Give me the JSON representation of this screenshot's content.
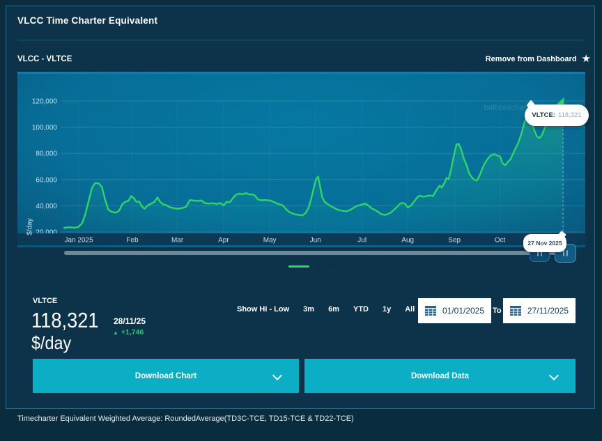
{
  "window": {
    "title": "VLCC Time Charter Equivalent"
  },
  "subheader": {
    "subtitle": "VLCC - VLTCE",
    "remove_label": "Remove from Dashboard",
    "star_icon": "★"
  },
  "chart_data": {
    "type": "line",
    "title": "VLCC Time Charter Equivalent",
    "ylabel": "$/day",
    "ylim": [
      20000,
      120000
    ],
    "grid": true,
    "legend_position": "bottom",
    "watermark": "balticexchange.com",
    "y_ticks": [
      {
        "v": 20000,
        "label": "20,000"
      },
      {
        "v": 40000,
        "label": "40,000"
      },
      {
        "v": 60000,
        "label": "60,000"
      },
      {
        "v": 80000,
        "label": "80,000"
      },
      {
        "v": 100000,
        "label": "100,000"
      },
      {
        "v": 120000,
        "label": "120,000"
      }
    ],
    "x_ticks": [
      {
        "f": 0.028,
        "label": "Jan 2025"
      },
      {
        "f": 0.13,
        "label": "Feb"
      },
      {
        "f": 0.216,
        "label": "Mar"
      },
      {
        "f": 0.304,
        "label": "Apr"
      },
      {
        "f": 0.392,
        "label": "May"
      },
      {
        "f": 0.479,
        "label": "Jun"
      },
      {
        "f": 0.568,
        "label": "Jul"
      },
      {
        "f": 0.655,
        "label": "Aug"
      },
      {
        "f": 0.744,
        "label": "Sep"
      },
      {
        "f": 0.831,
        "label": "Oct"
      }
    ],
    "cursor": {
      "f": 0.951,
      "date": "27 Nov 2025",
      "series_label": "VLTCE:",
      "value_label": "118,321",
      "value": 118321
    },
    "series": [
      {
        "name": "VLTCE",
        "color": "#2fd566",
        "points": [
          [
            0.0,
            23200
          ],
          [
            0.01,
            23600
          ],
          [
            0.02,
            23300
          ],
          [
            0.027,
            23800
          ],
          [
            0.034,
            26500
          ],
          [
            0.04,
            33000
          ],
          [
            0.047,
            44000
          ],
          [
            0.053,
            53500
          ],
          [
            0.059,
            57400
          ],
          [
            0.066,
            57100
          ],
          [
            0.072,
            54500
          ],
          [
            0.078,
            45000
          ],
          [
            0.084,
            37200
          ],
          [
            0.091,
            35300
          ],
          [
            0.099,
            34800
          ],
          [
            0.105,
            36400
          ],
          [
            0.111,
            41300
          ],
          [
            0.117,
            43100
          ],
          [
            0.123,
            44000
          ],
          [
            0.128,
            47400
          ],
          [
            0.133,
            45800
          ],
          [
            0.138,
            42900
          ],
          [
            0.143,
            43400
          ],
          [
            0.148,
            39800
          ],
          [
            0.153,
            37700
          ],
          [
            0.159,
            40100
          ],
          [
            0.166,
            41700
          ],
          [
            0.172,
            42900
          ],
          [
            0.178,
            46400
          ],
          [
            0.183,
            43000
          ],
          [
            0.189,
            41100
          ],
          [
            0.195,
            40500
          ],
          [
            0.201,
            39000
          ],
          [
            0.208,
            38300
          ],
          [
            0.216,
            37700
          ],
          [
            0.224,
            38200
          ],
          [
            0.232,
            39100
          ],
          [
            0.24,
            44400
          ],
          [
            0.248,
            44000
          ],
          [
            0.255,
            43700
          ],
          [
            0.262,
            44100
          ],
          [
            0.268,
            42100
          ],
          [
            0.276,
            41700
          ],
          [
            0.284,
            41900
          ],
          [
            0.291,
            41400
          ],
          [
            0.298,
            42100
          ],
          [
            0.304,
            40300
          ],
          [
            0.31,
            43100
          ],
          [
            0.316,
            42700
          ],
          [
            0.322,
            46100
          ],
          [
            0.328,
            48500
          ],
          [
            0.334,
            49300
          ],
          [
            0.34,
            48800
          ],
          [
            0.347,
            49700
          ],
          [
            0.353,
            48600
          ],
          [
            0.359,
            48800
          ],
          [
            0.364,
            47700
          ],
          [
            0.37,
            44700
          ],
          [
            0.377,
            44200
          ],
          [
            0.383,
            44400
          ],
          [
            0.392,
            44100
          ],
          [
            0.398,
            43300
          ],
          [
            0.404,
            42000
          ],
          [
            0.41,
            41200
          ],
          [
            0.416,
            40500
          ],
          [
            0.422,
            37900
          ],
          [
            0.428,
            35500
          ],
          [
            0.434,
            34300
          ],
          [
            0.441,
            33400
          ],
          [
            0.448,
            33000
          ],
          [
            0.454,
            32700
          ],
          [
            0.46,
            34300
          ],
          [
            0.466,
            38600
          ],
          [
            0.471,
            45500
          ],
          [
            0.476,
            54000
          ],
          [
            0.48,
            60000
          ],
          [
            0.484,
            62400
          ],
          [
            0.488,
            54500
          ],
          [
            0.492,
            46500
          ],
          [
            0.497,
            43000
          ],
          [
            0.503,
            41000
          ],
          [
            0.509,
            39500
          ],
          [
            0.515,
            38300
          ],
          [
            0.521,
            37100
          ],
          [
            0.527,
            36500
          ],
          [
            0.533,
            36000
          ],
          [
            0.539,
            35900
          ],
          [
            0.545,
            36800
          ],
          [
            0.551,
            38300
          ],
          [
            0.557,
            39700
          ],
          [
            0.563,
            40400
          ],
          [
            0.568,
            41000
          ],
          [
            0.574,
            41700
          ],
          [
            0.58,
            40100
          ],
          [
            0.586,
            38100
          ],
          [
            0.592,
            36900
          ],
          [
            0.598,
            35500
          ],
          [
            0.604,
            33700
          ],
          [
            0.61,
            33100
          ],
          [
            0.616,
            33500
          ],
          [
            0.622,
            34700
          ],
          [
            0.628,
            36700
          ],
          [
            0.634,
            38900
          ],
          [
            0.64,
            41500
          ],
          [
            0.645,
            42200
          ],
          [
            0.65,
            41500
          ],
          [
            0.655,
            38700
          ],
          [
            0.661,
            40100
          ],
          [
            0.667,
            43200
          ],
          [
            0.673,
            46400
          ],
          [
            0.678,
            47700
          ],
          [
            0.684,
            46900
          ],
          [
            0.69,
            47300
          ],
          [
            0.697,
            47900
          ],
          [
            0.703,
            47400
          ],
          [
            0.71,
            52200
          ],
          [
            0.716,
            55500
          ],
          [
            0.72,
            53900
          ],
          [
            0.725,
            57500
          ],
          [
            0.729,
            61200
          ],
          [
            0.733,
            60300
          ],
          [
            0.738,
            68500
          ],
          [
            0.743,
            78500
          ],
          [
            0.748,
            86800
          ],
          [
            0.752,
            87400
          ],
          [
            0.757,
            82800
          ],
          [
            0.762,
            75800
          ],
          [
            0.767,
            71300
          ],
          [
            0.772,
            64800
          ],
          [
            0.777,
            61800
          ],
          [
            0.782,
            59800
          ],
          [
            0.787,
            59300
          ],
          [
            0.792,
            63200
          ],
          [
            0.797,
            68200
          ],
          [
            0.802,
            72600
          ],
          [
            0.808,
            76100
          ],
          [
            0.814,
            78700
          ],
          [
            0.82,
            79300
          ],
          [
            0.826,
            78400
          ],
          [
            0.831,
            77700
          ],
          [
            0.836,
            72200
          ],
          [
            0.841,
            71000
          ],
          [
            0.846,
            73600
          ],
          [
            0.851,
            75700
          ],
          [
            0.856,
            80200
          ],
          [
            0.861,
            84300
          ],
          [
            0.866,
            88400
          ],
          [
            0.871,
            94300
          ],
          [
            0.876,
            101500
          ],
          [
            0.881,
            107800
          ],
          [
            0.886,
            109400
          ],
          [
            0.891,
            103800
          ],
          [
            0.896,
            97800
          ],
          [
            0.901,
            93100
          ],
          [
            0.906,
            91600
          ],
          [
            0.911,
            94200
          ],
          [
            0.916,
            99300
          ],
          [
            0.921,
            104200
          ],
          [
            0.926,
            108600
          ],
          [
            0.931,
            110600
          ],
          [
            0.936,
            112400
          ],
          [
            0.941,
            114300
          ],
          [
            0.946,
            116300
          ],
          [
            0.951,
            118321
          ]
        ]
      }
    ]
  },
  "scrollbar": {
    "handle_icon": "pause-bars"
  },
  "stats": {
    "instrument": "VLTCE",
    "value": "118,321",
    "unit": "$/day",
    "date": "28/11/25",
    "change_icon": "▲",
    "change": "+1,746",
    "change_color": "#2ecc71"
  },
  "controls": {
    "hi_low_label": "Show Hi - Low",
    "ranges": [
      "3m",
      "6m",
      "YTD",
      "1y",
      "All"
    ],
    "from_value": "01/01/2025",
    "to_label": "To",
    "to_value": "27/11/2025"
  },
  "downloads": {
    "chart_label": "Download Chart",
    "data_label": "Download Data"
  },
  "footer": {
    "note": "Timecharter Equivalent Weighted Average: RoundedAverage(TD3C-TCE, TD15-TCE & TD22-TCE)"
  }
}
